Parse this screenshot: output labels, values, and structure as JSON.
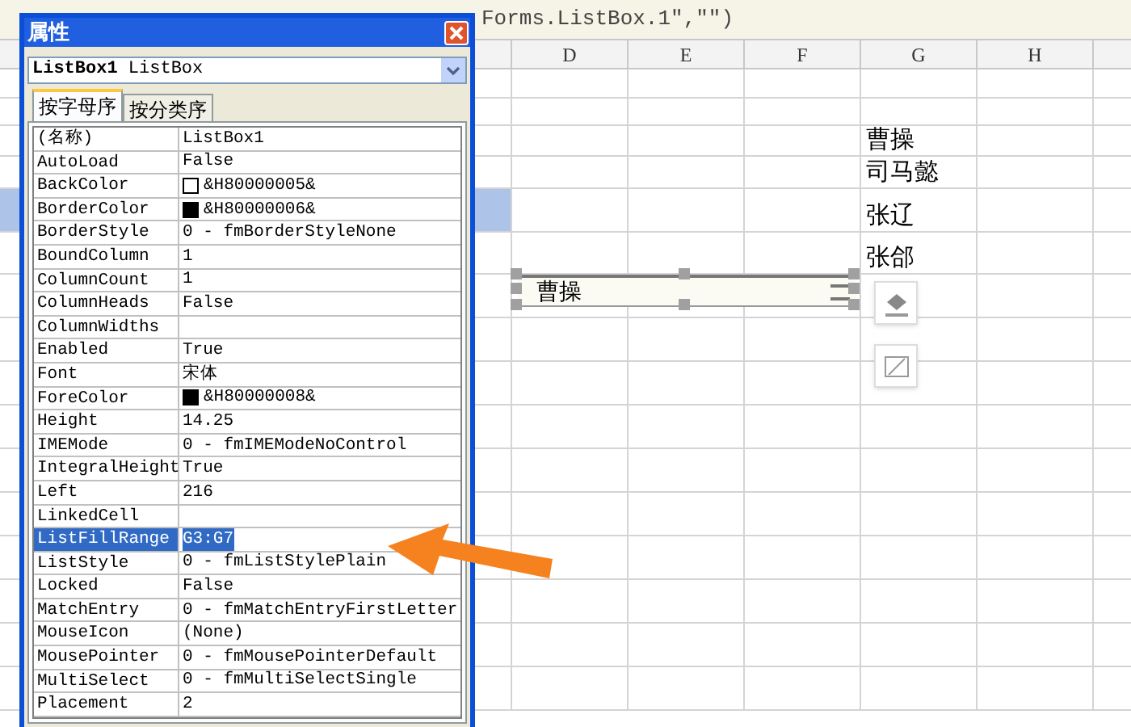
{
  "formula_bar": {
    "text": "Forms.ListBox.1\",\"\")"
  },
  "sheet": {
    "columns": [
      "D",
      "E",
      "F",
      "G",
      "H"
    ],
    "g_cells": [
      "曹操",
      "司马懿",
      "张辽",
      "张郃"
    ],
    "list_control": {
      "value": "曹操",
      "selected": true
    }
  },
  "properties_window": {
    "title": "属性",
    "object": {
      "name": "ListBox1",
      "type": "ListBox"
    },
    "tabs": [
      {
        "label": "按字母序",
        "selected": true
      },
      {
        "label": "按分类序",
        "selected": false
      }
    ],
    "rows": [
      {
        "name": "(名称)",
        "value": "ListBox1",
        "selected": false
      },
      {
        "name": "AutoLoad",
        "value": "False",
        "selected": false
      },
      {
        "name": "BackColor",
        "value": "&H80000005&",
        "kind": "color",
        "color": "#ffffff",
        "selected": false
      },
      {
        "name": "BorderColor",
        "value": "&H80000006&",
        "kind": "color",
        "color": "#000000",
        "selected": false
      },
      {
        "name": "BorderStyle",
        "value": "0 - fmBorderStyleNone",
        "selected": false
      },
      {
        "name": "BoundColumn",
        "value": "1",
        "selected": false
      },
      {
        "name": "ColumnCount",
        "value": "1",
        "selected": false
      },
      {
        "name": "ColumnHeads",
        "value": "False",
        "selected": false
      },
      {
        "name": "ColumnWidths",
        "selected": false
      },
      {
        "name": "Enabled",
        "value": "True",
        "selected": false
      },
      {
        "name": "Font",
        "value": "宋体",
        "selected": false
      },
      {
        "name": "ForeColor",
        "value": "&H80000008&",
        "kind": "color",
        "color": "#000000",
        "selected": false
      },
      {
        "name": "Height",
        "value": "14.25",
        "selected": false
      },
      {
        "name": "IMEMode",
        "value": "0 - fmIMEModeNoControl",
        "selected": false
      },
      {
        "name": "IntegralHeight",
        "value": "True",
        "selected": false
      },
      {
        "name": "Left",
        "value": "216",
        "selected": false
      },
      {
        "name": "LinkedCell",
        "selected": false
      },
      {
        "name": "ListFillRange",
        "value": "G3:G7",
        "selected": true
      },
      {
        "name": "ListStyle",
        "value": "0 - fmListStylePlain",
        "selected": false
      },
      {
        "name": "Locked",
        "value": "False",
        "selected": false
      },
      {
        "name": "MatchEntry",
        "value": "0 - fmMatchEntryFirstLetter",
        "selected": false
      },
      {
        "name": "MouseIcon",
        "value": "(None)",
        "selected": false
      },
      {
        "name": "MousePointer",
        "value": "0 - fmMousePointerDefault",
        "selected": false
      },
      {
        "name": "MultiSelect",
        "value": "0 - fmMultiSelectSingle",
        "selected": false
      },
      {
        "name": "Placement",
        "value": "2",
        "selected": false
      }
    ]
  }
}
